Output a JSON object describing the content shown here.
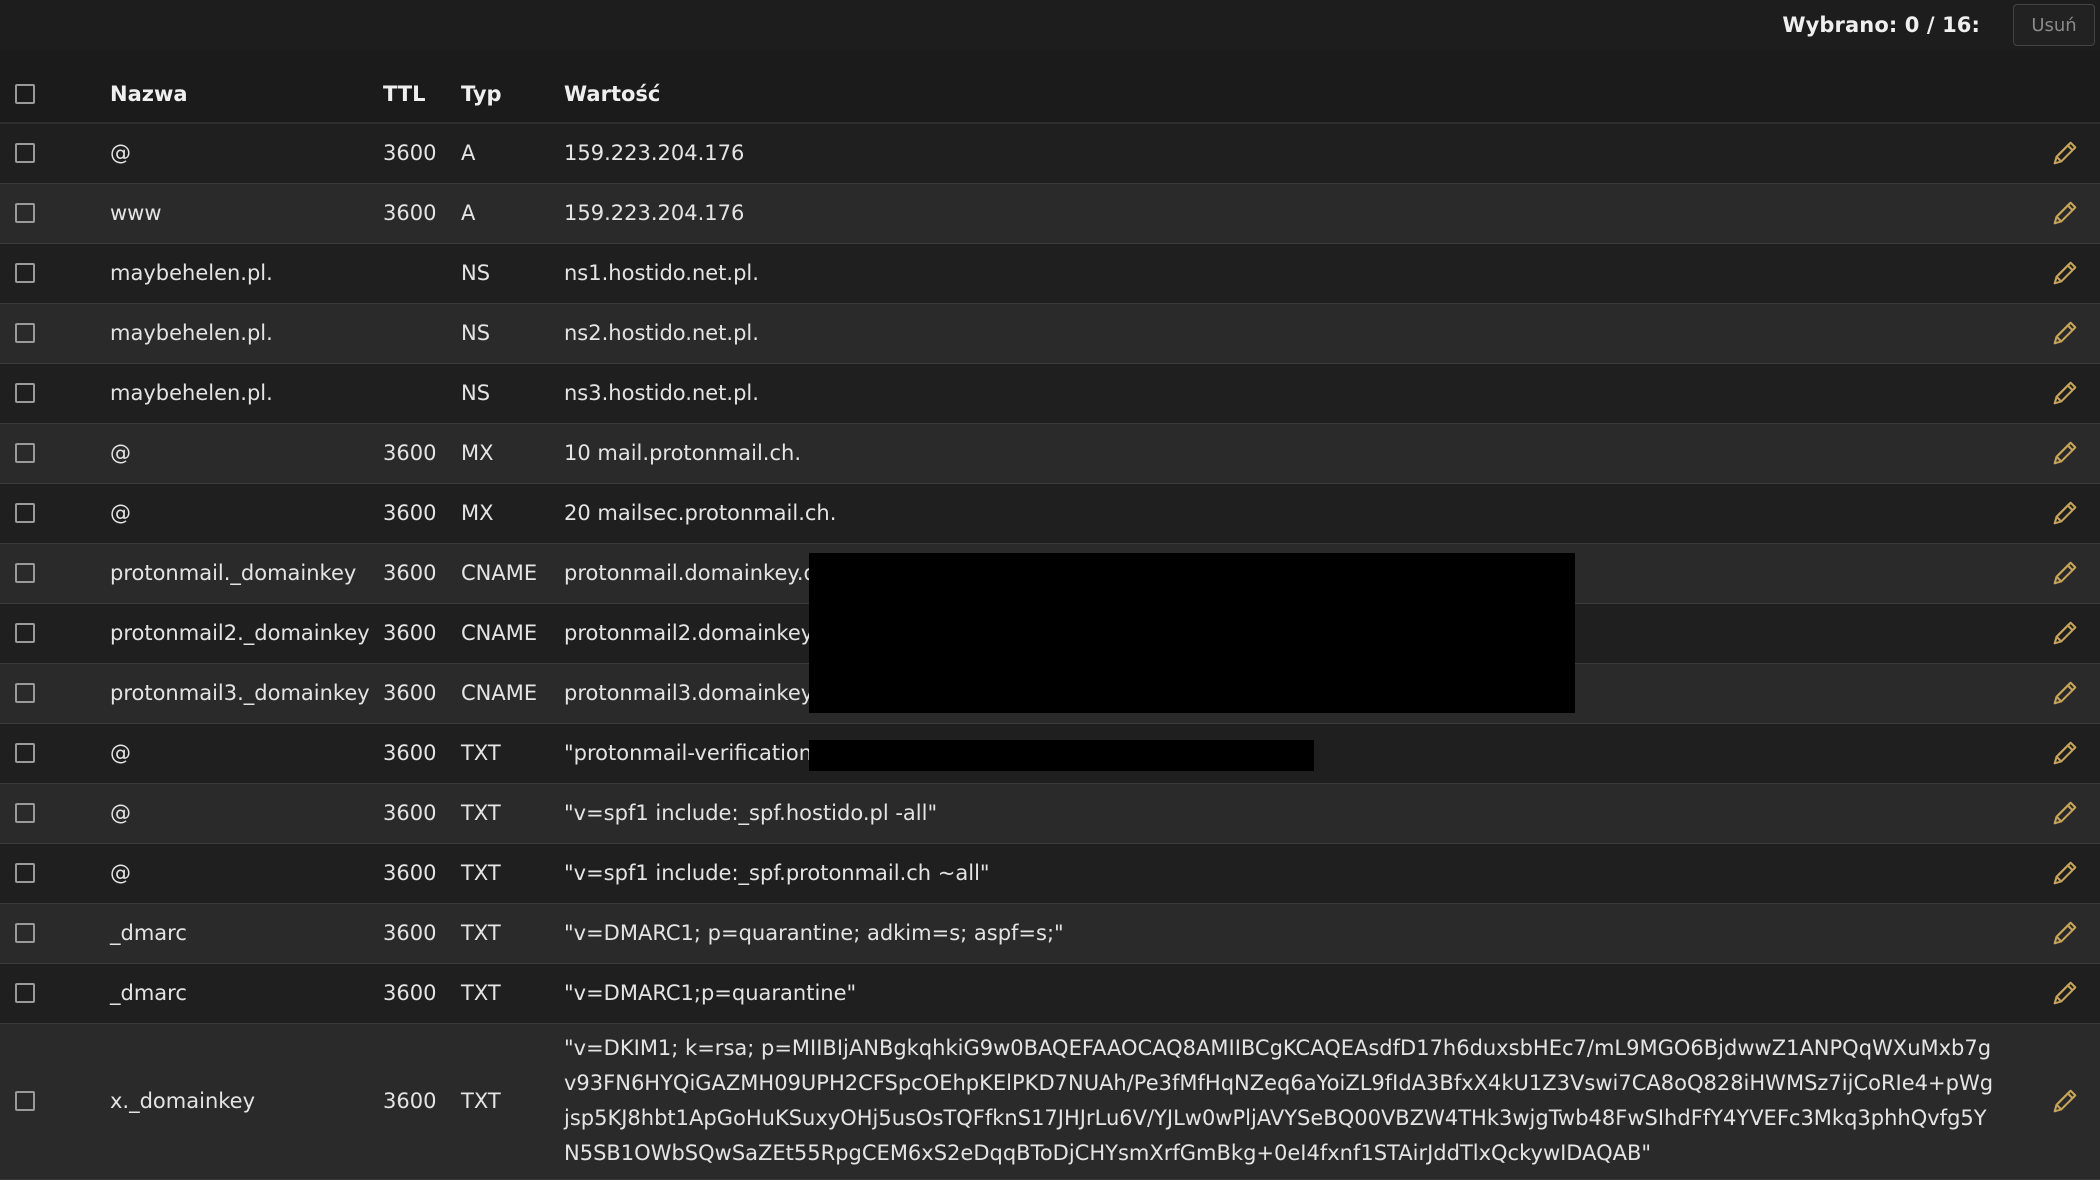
{
  "toolbar": {
    "selected_count": "Wybrano: 0 / 16:",
    "delete_label": "Usuń"
  },
  "table": {
    "headers": {
      "name": "Nazwa",
      "ttl": "TTL",
      "type": "Typ",
      "value": "Wartość"
    },
    "rows": [
      {
        "name": "@",
        "ttl": "3600",
        "type": "A",
        "value": "159.223.204.176"
      },
      {
        "name": "www",
        "ttl": "3600",
        "type": "A",
        "value": "159.223.204.176"
      },
      {
        "name": "maybehelen.pl.",
        "ttl": "",
        "type": "NS",
        "value": "ns1.hostido.net.pl."
      },
      {
        "name": "maybehelen.pl.",
        "ttl": "",
        "type": "NS",
        "value": "ns2.hostido.net.pl."
      },
      {
        "name": "maybehelen.pl.",
        "ttl": "",
        "type": "NS",
        "value": "ns3.hostido.net.pl."
      },
      {
        "name": "@",
        "ttl": "3600",
        "type": "MX",
        "value": "10 mail.protonmail.ch."
      },
      {
        "name": "@",
        "ttl": "3600",
        "type": "MX",
        "value": "20 mailsec.protonmail.ch."
      },
      {
        "name": "protonmail._domainkey",
        "ttl": "3600",
        "type": "CNAME",
        "value": "protonmail.domainkey.da"
      },
      {
        "name": "protonmail2._domainkey",
        "ttl": "3600",
        "type": "CNAME",
        "value": "protonmail2.domainkey.d"
      },
      {
        "name": "protonmail3._domainkey",
        "ttl": "3600",
        "type": "CNAME",
        "value": "protonmail3.domainkey.d"
      },
      {
        "name": "@",
        "ttl": "3600",
        "type": "TXT",
        "value": "\"protonmail-verification="
      },
      {
        "name": "@",
        "ttl": "3600",
        "type": "TXT",
        "value": "\"v=spf1 include:_spf.hostido.pl -all\""
      },
      {
        "name": "@",
        "ttl": "3600",
        "type": "TXT",
        "value": "\"v=spf1 include:_spf.protonmail.ch ~all\""
      },
      {
        "name": "_dmarc",
        "ttl": "3600",
        "type": "TXT",
        "value": "\"v=DMARC1; p=quarantine; adkim=s; aspf=s;\""
      },
      {
        "name": "_dmarc",
        "ttl": "3600",
        "type": "TXT",
        "value": "\"v=DMARC1;p=quarantine\""
      },
      {
        "name": "x._domainkey",
        "ttl": "3600",
        "type": "TXT",
        "value": "\"v=DKIM1; k=rsa; p=MIIBIjANBgkqhkiG9w0BAQEFAAOCAQ8AMIIBCgKCAQEAsdfD17h6duxsbHEc7/mL9MGO6BjdwwZ1ANPQqWXuMxb7gv93FN6HYQiGAZMH09UPH2CFSpcOEhpKElPKD7NUAh/Pe3fMfHqNZeq6aYoiZL9fIdA3BfxX4kU1Z3Vswi7CA8oQ828iHWMSz7ijCoRIe4+pWgjsp5KJ8hbt1ApGoHuKSuxyOHj5usOsTQFfknS17JHJrLu6V/YJLw0wPljAVYSeBQ00VBZW4THk3wjgTwb48FwSIhdFfY4YVEFc3Mkq3phhQvfg5YN5SB1OWbSQwSaZEt55RpgCEM6xS2eDqqBToDjCHYsmXrfGmBkg+0eI4fxnf1STAirJddTlxQckywIDAQAB\""
      }
    ]
  },
  "icons": {
    "edit": "pencil-icon",
    "edit_color": "#c8a45b"
  },
  "colors": {
    "background": "#1b1b1b",
    "row_odd": "#1f1f1f",
    "row_even": "#2a2a2a",
    "redaction": "#000000"
  }
}
